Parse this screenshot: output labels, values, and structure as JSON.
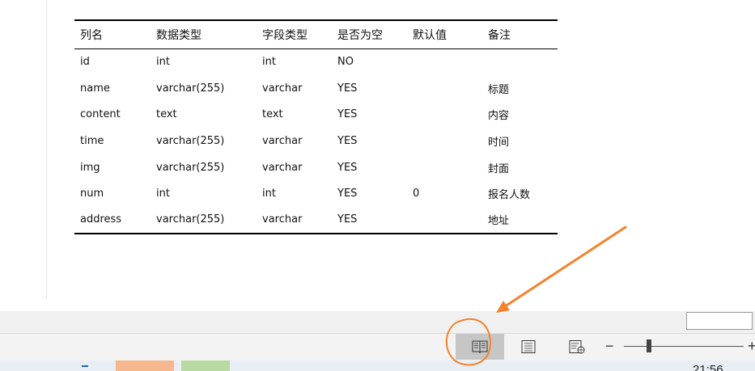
{
  "table": {
    "headers": [
      "列名",
      "数据类型",
      "字段类型",
      "是否为空",
      "默认值",
      "备注"
    ],
    "rows": [
      [
        "id",
        "int",
        "int",
        "NO",
        "",
        ""
      ],
      [
        "name",
        "varchar(255)",
        "varchar",
        "YES",
        "",
        "标题"
      ],
      [
        "content",
        "text",
        "text",
        "YES",
        "",
        "内容"
      ],
      [
        "time",
        "varchar(255)",
        "varchar",
        "YES",
        "",
        "时间"
      ],
      [
        "img",
        "varchar(255)",
        "varchar",
        "YES",
        "",
        "封面"
      ],
      [
        "num",
        "int",
        "int",
        "YES",
        "0",
        "报名人数"
      ],
      [
        "address",
        "varchar(255)",
        "varchar",
        "YES",
        "",
        "地址"
      ]
    ]
  },
  "status_bar": {
    "views": [
      {
        "name": "read-mode",
        "icon": "book-icon",
        "active": true
      },
      {
        "name": "print-layout",
        "icon": "page-icon",
        "active": false
      },
      {
        "name": "web-layout",
        "icon": "web-page-icon",
        "active": false
      }
    ],
    "zoom_minus": "−",
    "zoom_plus": "+"
  },
  "taskbar": {
    "clock": "21:56"
  },
  "colors": {
    "annotation": "#f5822d",
    "active_view_bg": "#c6c6c6"
  }
}
